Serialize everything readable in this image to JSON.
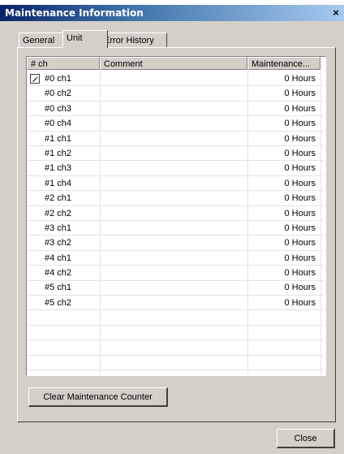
{
  "window": {
    "title": "Maintenance Information",
    "close_glyph": "×"
  },
  "tabs": [
    "General",
    "Unit",
    "Error History"
  ],
  "columns": [
    "# ch",
    "Comment",
    "Maintenance..."
  ],
  "rows": [
    {
      "ch": "#0 ch1",
      "comment": "",
      "maintenance": "0 Hours",
      "icon": "pencil-icon"
    },
    {
      "ch": "#0 ch2",
      "comment": "",
      "maintenance": "0 Hours"
    },
    {
      "ch": "#0 ch3",
      "comment": "",
      "maintenance": "0 Hours"
    },
    {
      "ch": "#0 ch4",
      "comment": "",
      "maintenance": "0 Hours"
    },
    {
      "ch": "#1 ch1",
      "comment": "",
      "maintenance": "0 Hours"
    },
    {
      "ch": "#1 ch2",
      "comment": "",
      "maintenance": "0 Hours"
    },
    {
      "ch": "#1 ch3",
      "comment": "",
      "maintenance": "0 Hours"
    },
    {
      "ch": "#1 ch4",
      "comment": "",
      "maintenance": "0 Hours"
    },
    {
      "ch": "#2 ch1",
      "comment": "",
      "maintenance": "0 Hours"
    },
    {
      "ch": "#2 ch2",
      "comment": "",
      "maintenance": "0 Hours"
    },
    {
      "ch": "#3 ch1",
      "comment": "",
      "maintenance": "0 Hours"
    },
    {
      "ch": "#3 ch2",
      "comment": "",
      "maintenance": "0 Hours"
    },
    {
      "ch": "#4 ch1",
      "comment": "",
      "maintenance": "0 Hours"
    },
    {
      "ch": "#4 ch2",
      "comment": "",
      "maintenance": "0 Hours"
    },
    {
      "ch": "#5 ch1",
      "comment": "",
      "maintenance": "0 Hours"
    },
    {
      "ch": "#5 ch2",
      "comment": "",
      "maintenance": "0 Hours"
    }
  ],
  "buttons": {
    "clear": "Clear Maintenance Counter",
    "close": "Close"
  },
  "colors": {
    "face": "#d4d0c8",
    "title_start": "#0a246a",
    "title_end": "#a6caf0"
  }
}
